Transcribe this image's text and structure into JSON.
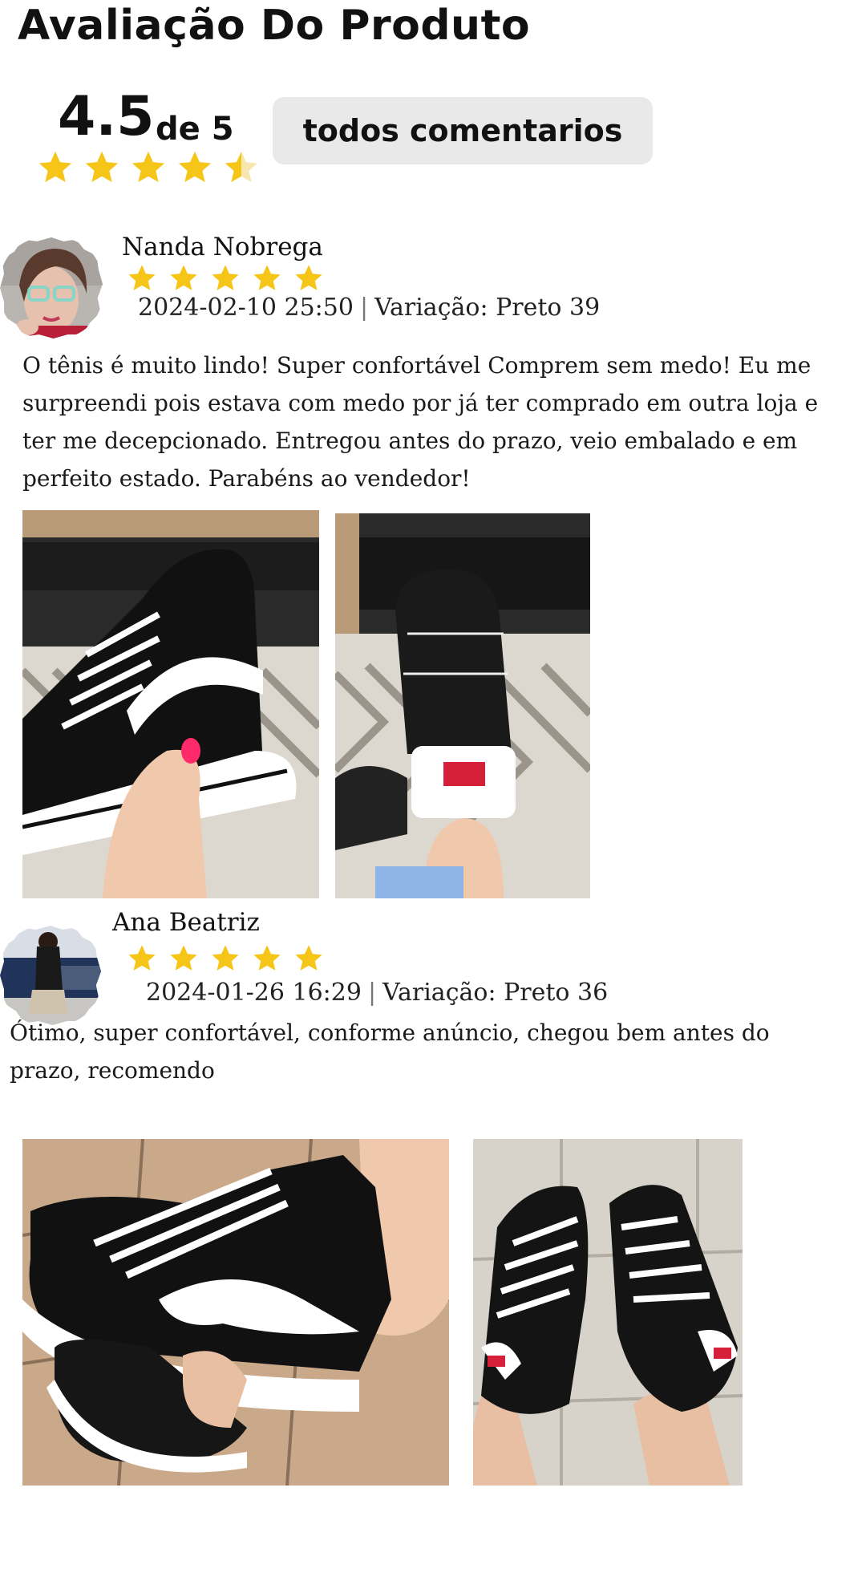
{
  "header": {
    "title": "Avaliação Do Produto"
  },
  "summary": {
    "score": "4.5",
    "of_label": "de 5",
    "rating_value": 4.5,
    "rating_max": 5,
    "all_comments_label": "todos comentarios"
  },
  "colors": {
    "star": "#f5c518",
    "button_bg": "#e9e9e9"
  },
  "reviews": [
    {
      "name": "Nanda Nobrega",
      "rating": 5,
      "date": "2024-02-10 25:50",
      "variation": "Variação: Preto 39",
      "text": "O tênis é muito lindo! Super confortável  Comprem sem medo! Eu me surpreendi pois estava com medo por já ter comprado em outra loja e ter me decepcionado. Entregou antes do prazo, veio embalado e em perfeito estado. Parabéns ao vendedor!",
      "photos": [
        "black-white-high-top-sneaker-side-view",
        "black-white-high-top-sneaker-heel-view"
      ]
    },
    {
      "name": "Ana  Beatriz",
      "rating": 5,
      "date": "2024-01-26 16:29",
      "variation": "Variação: Preto 36",
      "text": "Ótimo, super confortável, conforme anúncio, chegou bem antes do prazo, recomendo",
      "photos": [
        "sneakers-worn-side-view",
        "sneakers-worn-top-view"
      ]
    }
  ]
}
